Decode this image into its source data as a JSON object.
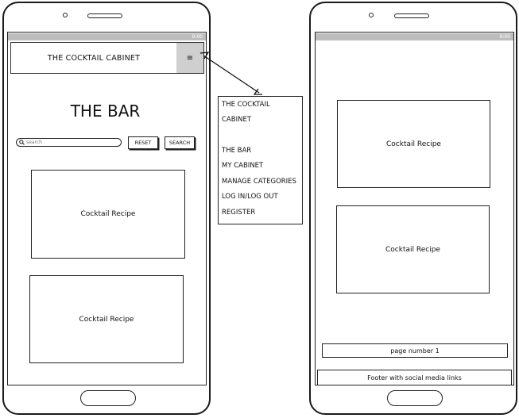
{
  "status_bar": {
    "time": "9:00"
  },
  "left_phone": {
    "header_title": "THE COCKTAIL CABINET",
    "hamburger_icon": "hamburger-icon",
    "page_title": "THE BAR",
    "search_placeholder": "search",
    "reset_label": "RESET",
    "search_label": "SEARCH",
    "cards": [
      "Cocktail Recipe",
      "Cocktail Recipe"
    ]
  },
  "nav_menu": {
    "brand_line1": "THE COCKTAIL",
    "brand_line2": "CABINET",
    "items": [
      "THE BAR",
      "MY CABINET",
      "MANAGE CATEGORIES",
      "LOG IN/LOG OUT",
      "REGISTER"
    ]
  },
  "right_phone": {
    "cards": [
      "Cocktail Recipe",
      "Cocktail Recipe"
    ],
    "pagination": "page number 1",
    "footer": "Footer with social media links"
  }
}
